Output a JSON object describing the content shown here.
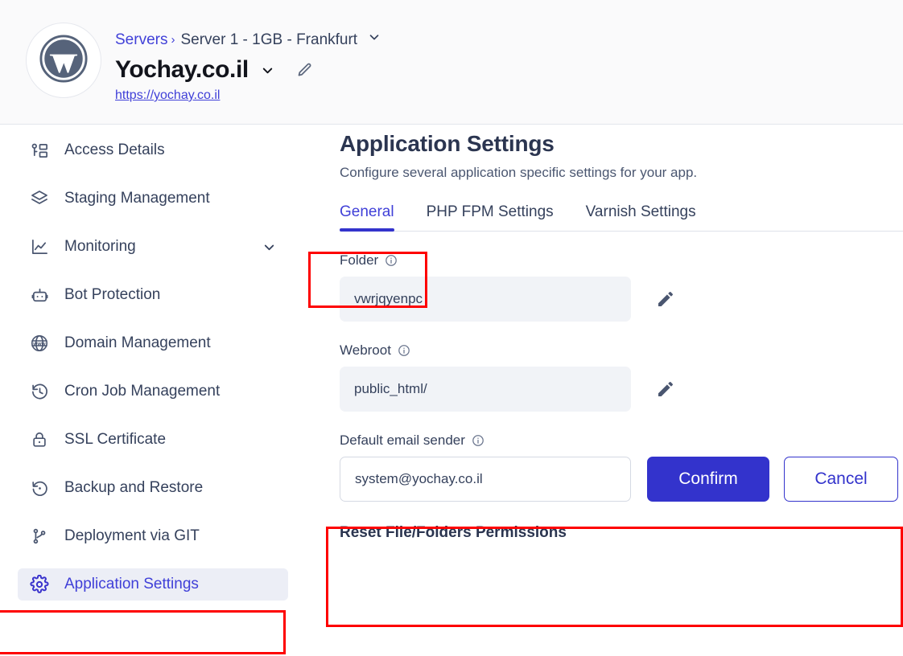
{
  "header": {
    "avatar_icon": "wordpress-logo",
    "breadcrumb": {
      "parent": "Servers",
      "separator": "›",
      "current": "Server 1 - 1GB - Frankfurt",
      "caret_icon": "chevron-down-icon"
    },
    "site_title": "Yochay.co.il",
    "site_caret_icon": "chevron-down-icon",
    "site_edit_icon": "pencil-icon",
    "site_url": "https://yochay.co.il"
  },
  "sidebar": {
    "items": [
      {
        "label": "Access Details",
        "icon": "key-list-icon",
        "active": false,
        "caret": false
      },
      {
        "label": "Staging Management",
        "icon": "layers-icon",
        "active": false,
        "caret": false
      },
      {
        "label": "Monitoring",
        "icon": "chart-line-icon",
        "active": false,
        "caret": true
      },
      {
        "label": "Bot Protection",
        "icon": "robot-icon",
        "active": false,
        "caret": false
      },
      {
        "label": "Domain Management",
        "icon": "www-globe-icon",
        "active": false,
        "caret": false
      },
      {
        "label": "Cron Job Management",
        "icon": "clock-history-icon",
        "active": false,
        "caret": false
      },
      {
        "label": "SSL Certificate",
        "icon": "lock-icon",
        "active": false,
        "caret": false
      },
      {
        "label": "Backup and Restore",
        "icon": "restore-icon",
        "active": false,
        "caret": false
      },
      {
        "label": "Deployment via GIT",
        "icon": "git-branch-icon",
        "active": false,
        "caret": false
      },
      {
        "label": "Application Settings",
        "icon": "gear-icon",
        "active": true,
        "caret": false
      }
    ]
  },
  "main": {
    "title": "Application Settings",
    "subtitle": "Configure several application specific settings for your app.",
    "tabs": [
      {
        "label": "General",
        "active": true
      },
      {
        "label": "PHP FPM Settings",
        "active": false
      },
      {
        "label": "Varnish Settings",
        "active": false
      }
    ],
    "fields": {
      "folder": {
        "label": "Folder",
        "info_icon": "info-icon",
        "value": "vwrjqyenpc",
        "edit_icon": "pencil-icon"
      },
      "webroot": {
        "label": "Webroot",
        "info_icon": "info-icon",
        "value": "public_html/",
        "edit_icon": "pencil-icon"
      },
      "email_sender": {
        "label": "Default email sender",
        "info_icon": "info-icon",
        "value": "system@yochay.co.il",
        "confirm_label": "Confirm",
        "cancel_label": "Cancel"
      }
    },
    "bottom_section_heading": "Reset File/Folders Permissions"
  },
  "colors": {
    "accent": "#3333cc",
    "link": "#4040d8",
    "text": "#35415c",
    "heading": "#2b3550",
    "annotation": "#fe0000",
    "active_nav_bg": "#eceef6",
    "readonly_bg": "#f1f3f7"
  }
}
